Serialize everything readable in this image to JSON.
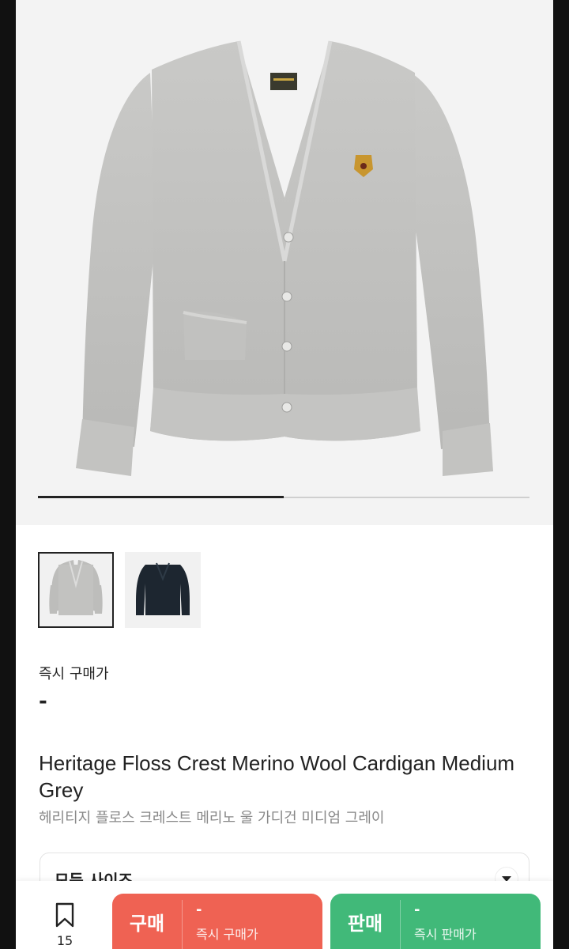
{
  "gallery": {
    "progress": 0.5,
    "thumbnails": [
      {
        "color": "grey",
        "selected": true
      },
      {
        "color": "navy",
        "selected": false
      }
    ]
  },
  "product": {
    "price_label": "즉시 구매가",
    "price_value": "-",
    "title_en": "Heritage Floss Crest Merino Wool Cardigan Medium Grey",
    "title_ko": "헤리티지 플로스 크레스트 메리노 울 가디건 미디엄 그레이"
  },
  "size_selector": {
    "label": "모든 사이즈"
  },
  "bottom_bar": {
    "bookmark_icon": "bookmark-icon",
    "bookmark_count": "15",
    "buy": {
      "label": "구매",
      "price": "-",
      "sub_label": "즉시 구매가",
      "color": "#ef6253"
    },
    "sell": {
      "label": "판매",
      "price": "-",
      "sub_label": "즉시 판매가",
      "color": "#41b979"
    }
  }
}
